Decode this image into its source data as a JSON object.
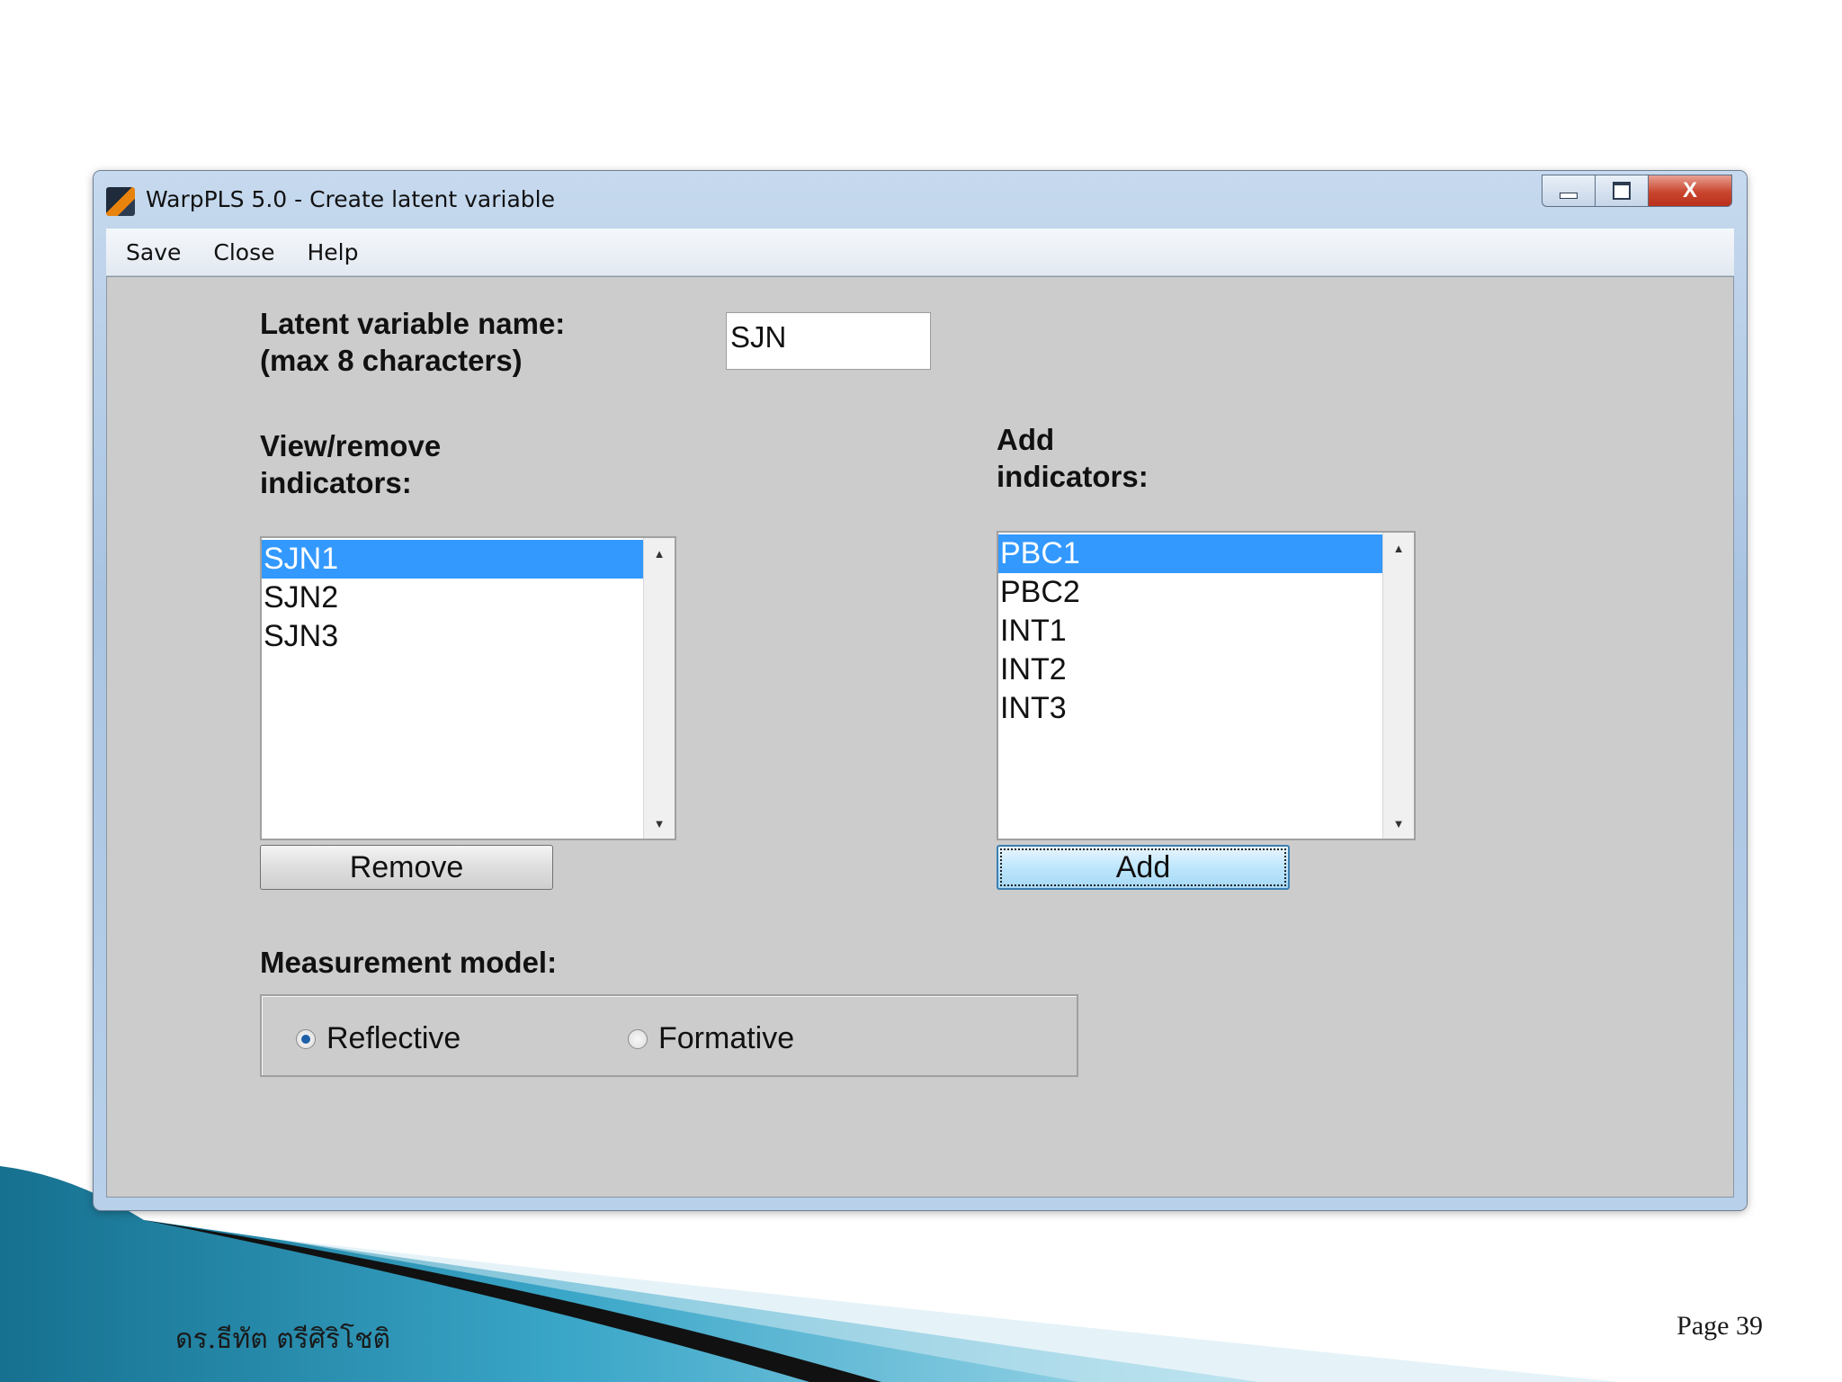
{
  "window": {
    "title": "WarpPLS 5.0 - Create latent variable",
    "controls": {
      "minimize": "minimize",
      "maximize": "maximize",
      "close": "X"
    }
  },
  "menu": {
    "items": [
      "Save",
      "Close",
      "Help"
    ]
  },
  "form": {
    "name_label_line1": "Latent variable name:",
    "name_label_line2": "(max 8 characters)",
    "name_value": "SJN",
    "view_label_line1": "View/remove",
    "view_label_line2": "indicators:",
    "add_label_line1": "Add",
    "add_label_line2": "indicators:",
    "current_indicators": [
      "SJN1",
      "SJN2",
      "SJN3"
    ],
    "current_selected": "SJN1",
    "available_indicators": [
      "PBC1",
      "PBC2",
      "INT1",
      "INT2",
      "INT3"
    ],
    "available_selected": "PBC1",
    "remove_button": "Remove",
    "add_button": "Add",
    "measurement_label": "Measurement model:",
    "measurement_options": [
      "Reflective",
      "Formative"
    ],
    "measurement_selected": "Reflective"
  },
  "slide": {
    "author": "ดร.ธีทัต ตรีศิริโชติ",
    "page": "Page 39"
  },
  "colors": {
    "selection": "#3399ff",
    "dialog_background": "#cccccc",
    "footer_accent": "#1f8fb8"
  }
}
